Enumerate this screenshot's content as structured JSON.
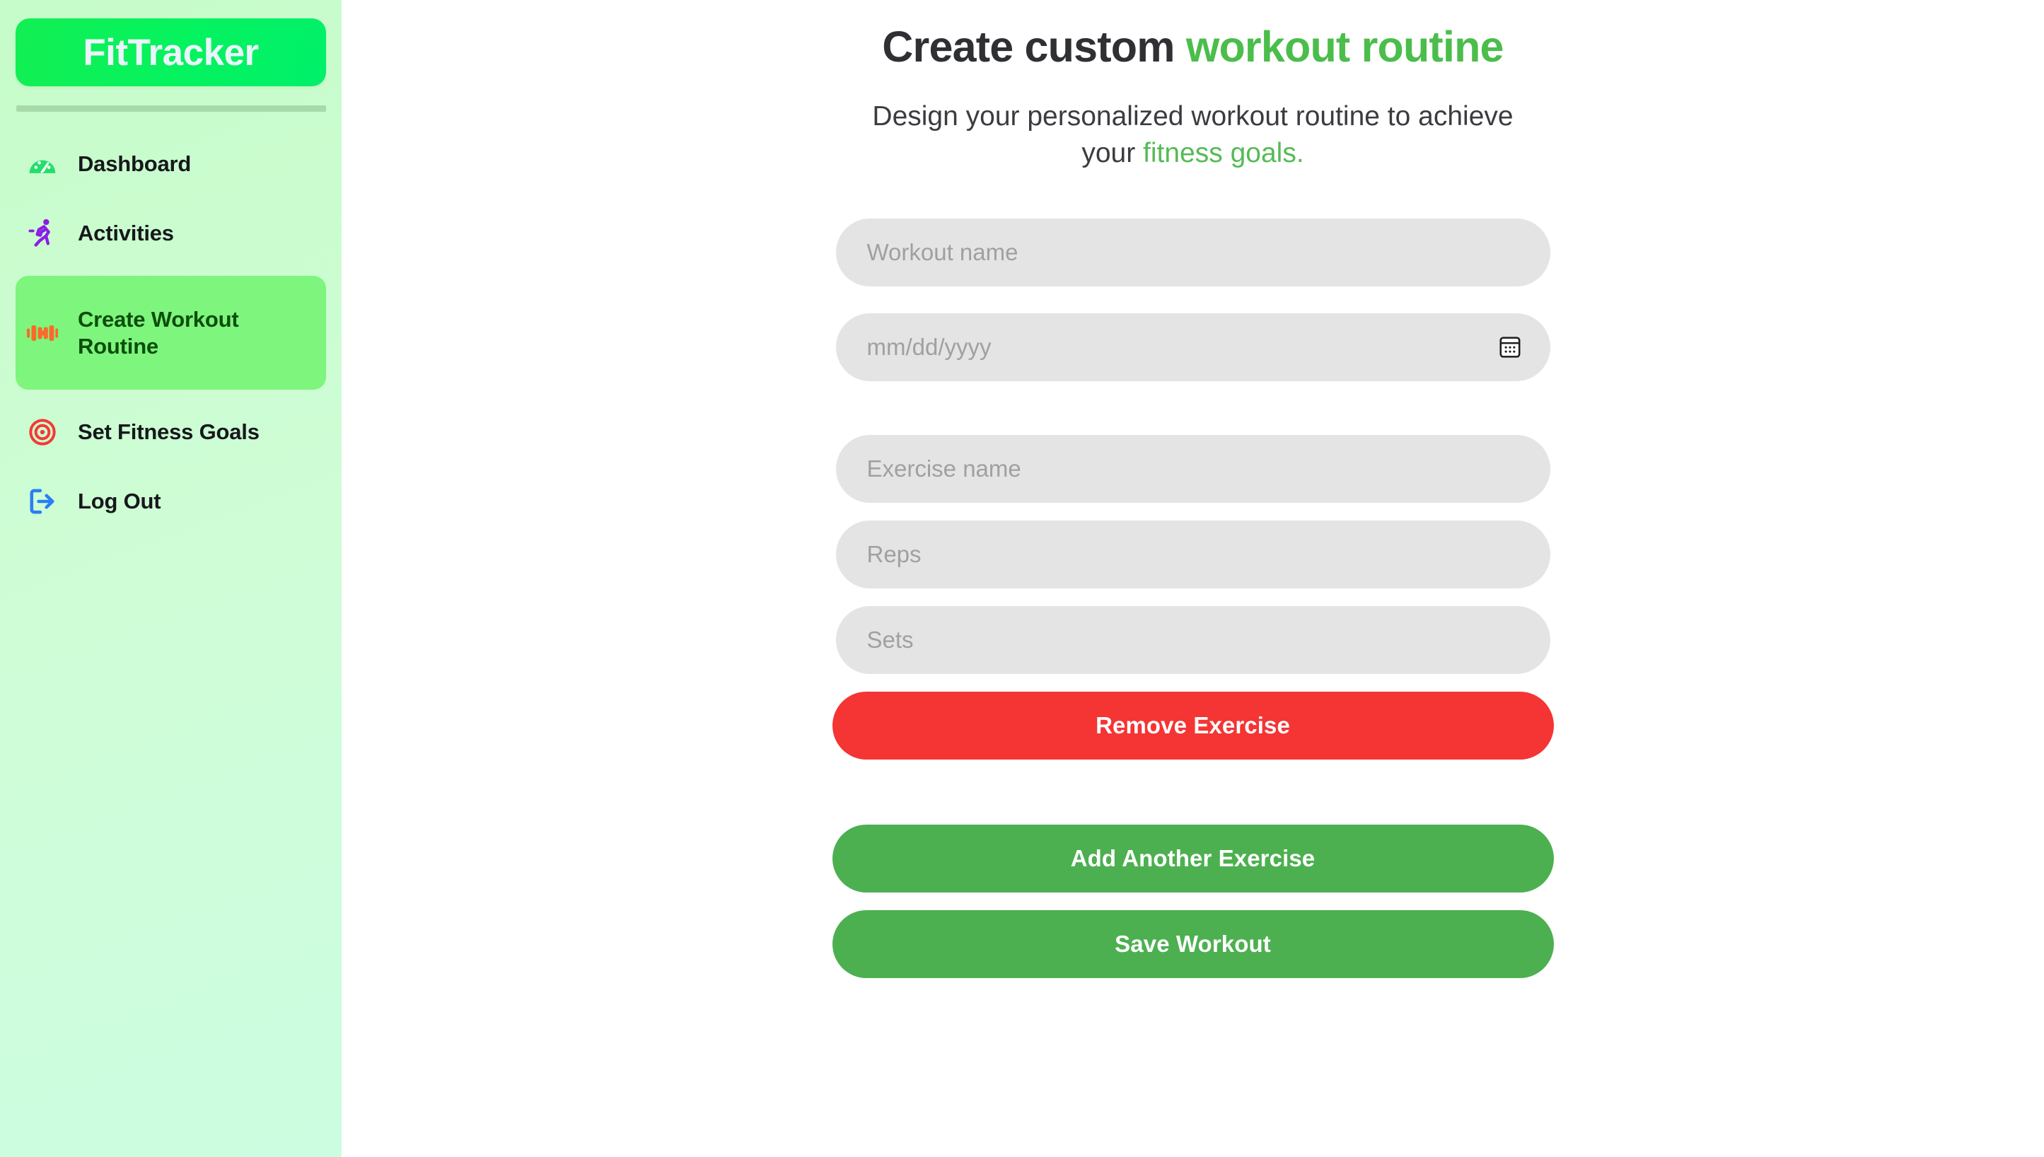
{
  "brand": {
    "name": "FitTracker",
    "gradient_from": "#12ef53",
    "gradient_to": "#00f06a",
    "text_color": "#eaf4fb"
  },
  "sidebar": {
    "background_from": "#c6fcc9",
    "background_to": "#ccfde0",
    "divider_color": "#a8d9ab",
    "active_background": "#7ef57c",
    "active_text_color": "#0b4d0c",
    "items": [
      {
        "label": "Dashboard",
        "icon": "speedometer-icon",
        "icon_color": "#22e06a",
        "active": false
      },
      {
        "label": "Activities",
        "icon": "running-person-icon",
        "icon_color": "#8b1ee6",
        "active": false
      },
      {
        "label": "Create Workout Routine",
        "icon": "dumbbell-icon",
        "icon_color": "#fa6a2a",
        "active": true
      },
      {
        "label": "Set Fitness Goals",
        "icon": "target-icon",
        "icon_color": "#f33a35",
        "active": false
      },
      {
        "label": "Log Out",
        "icon": "logout-arrow-icon",
        "icon_color": "#2b7df5",
        "active": false
      }
    ]
  },
  "header": {
    "title_plain": "Create custom ",
    "title_accent": "workout routine",
    "subtitle_plain": "Design your personalized workout routine to achieve your ",
    "subtitle_accent": "fitness goals.",
    "title_color": "#2f3033",
    "accent_color": "#4bbd4b"
  },
  "form": {
    "workout_name": {
      "placeholder": "Workout name",
      "value": ""
    },
    "workout_date": {
      "placeholder": "mm/dd/yyyy",
      "value": "",
      "picker_icon": "calendar-icon"
    },
    "exercise_name": {
      "placeholder": "Exercise name",
      "value": ""
    },
    "reps": {
      "placeholder": "Reps",
      "value": ""
    },
    "sets": {
      "placeholder": "Sets",
      "value": ""
    },
    "field_background": "#e4e4e5",
    "placeholder_color": "#a0a0a2"
  },
  "buttons": {
    "remove_exercise": {
      "label": "Remove Exercise",
      "color": "#f53434"
    },
    "add_another_exercise": {
      "label": "Add Another Exercise",
      "color": "#4cb050"
    },
    "save_workout": {
      "label": "Save Workout",
      "color": "#4cb050"
    }
  }
}
